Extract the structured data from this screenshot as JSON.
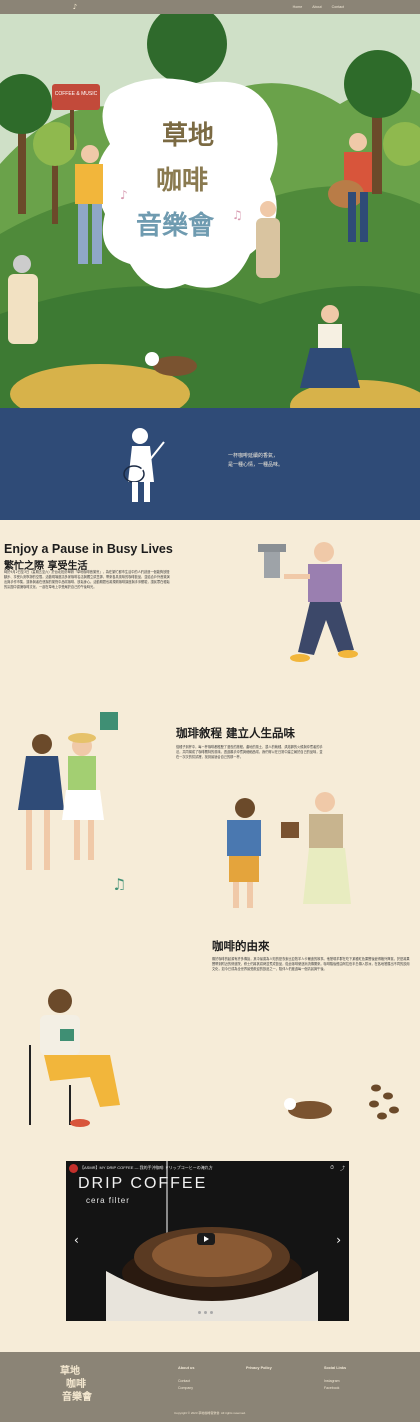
{
  "nav": {
    "logo_text": "♪",
    "links": [
      "Home",
      "About",
      "Contact"
    ]
  },
  "hero": {
    "title_line1": "草地",
    "title_line2": "咖啡",
    "title_line3": "音樂會",
    "sign_text": "COFFEE & MUSIC"
  },
  "band": {
    "lines": [
      "一杯咖啡延續的香氣，",
      "是一種心情，一種品味。"
    ]
  },
  "intro": {
    "title_en": "Enjoy a Pause in Busy Lives",
    "title_zh": "繁忙之際 享受生活",
    "body": "時於9月2日至3日（星期五至六）於台北松菸舉辦「草地咖啡音樂會」，為在繁忙都市生活中的人們創造一個能夠放慢腳步、享受片刻寧靜的空間。活動現場邀請多家咖啡名店與獨立烘豆師，帶來各具風味的咖啡飲品，並結合戶外音樂演出與手作市集，讓參與者在悠揚的樂聲中品嚐咖啡、放鬆身心。活動期間也將規劃咖啡講座與手沖體驗，讓民眾在輕鬆的氛圍中認識咖啡文化，一起在草地上享受屬於自己的午後時光。"
  },
  "craft": {
    "title": "珈琲敘程 建立人生品味",
    "body": "從種子到杯中，每一杯咖啡都經歷了漫長的旅程。產地的風土、農人的栽種、烘焙師的火候與沖煮者的手法，共同構成了咖啡獨特的風味。透過親手沖煮與細細品嚐，我們得以在日常中建立屬於自己的品味，並在一次次的嘗試裡，找到最適合自己的那一杯。"
  },
  "origin": {
    "title": "咖啡的由來",
    "body": "關於咖啡的起源有許多傳說，其中最廣為人知的是衣索比亞牧羊人卡爾迪的故事。他發現羊群在吃下某種紅色果實後變得格外興奮，於是將果實帶到附近的修道院，修士們將其烘烤並煮成飲品，從此咖啡便逐漸流傳開來。咖啡隨後經由阿拉伯半島傳入歐洲，在各地發展出不同的飲用文化，如今已成為全世界最受歡迎的飲品之一，陪伴人們度過每一個清晨與午後。"
  },
  "video": {
    "title": "【ASMR】MY DRIP COFFEE — 我的手沖咖啡 ドリップコーヒーの淹れ方",
    "overlay_title": "DRIP COFFEE",
    "overlay_sub": "cera filter",
    "tools": [
      "⏱",
      "⤴"
    ],
    "prev_arrow": "‹",
    "next_arrow": "›"
  },
  "footer": {
    "about": {
      "heading": "About us",
      "items": [
        "Contact",
        "Company"
      ]
    },
    "privacy": {
      "heading": "Privacy Policy",
      "items": []
    },
    "social": {
      "heading": "Social Links",
      "items": [
        "Instagram",
        "Facebook"
      ]
    },
    "copyright": "Copyright © 2023 草地咖啡音樂會. All rights reserved."
  },
  "colors": {
    "nav": "#8b8476",
    "cream": "#f6ecd8",
    "band": "#2f4b77",
    "grass": "#4f8a3a"
  }
}
